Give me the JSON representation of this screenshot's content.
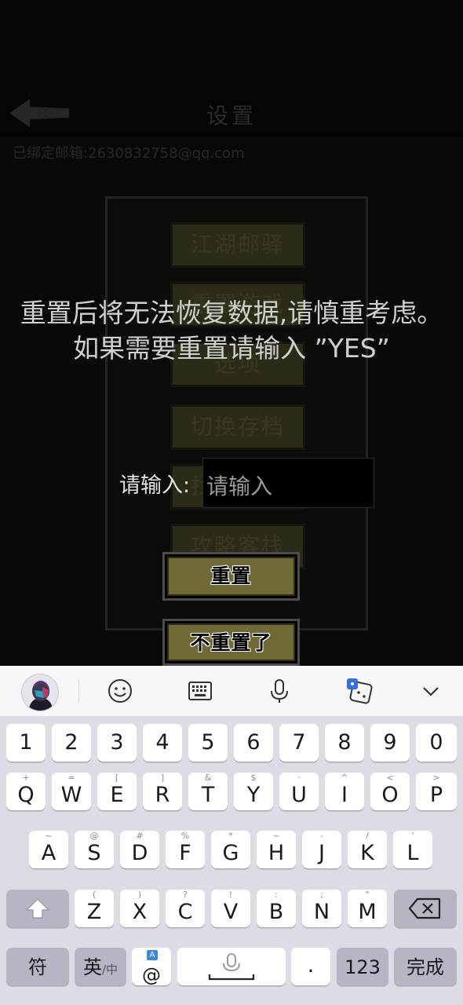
{
  "background": {
    "title": "设置",
    "email": "已绑定邮箱:2630832758@qq.com",
    "menu": [
      "江湖邮驿",
      "重置游戏",
      "选项",
      "切换存档",
      "找回存档",
      "攻略客栈"
    ]
  },
  "dialog": {
    "warning_line1": "重置后将无法恢复数据,请慎重考虑。",
    "warning_line2": "如果需要重置请输入 ”YES”",
    "input_label": "请输入:",
    "input_placeholder": "请输入",
    "input_value": "",
    "confirm_label": "重置",
    "cancel_label": "不重置了"
  },
  "keyboard": {
    "toolbar": [
      "avatar",
      "emoji-icon",
      "keyboard-icon",
      "microphone-icon",
      "dice-icon",
      "chevron-down-icon"
    ],
    "numbers": [
      "1",
      "2",
      "3",
      "4",
      "5",
      "6",
      "7",
      "8",
      "9",
      "0"
    ],
    "row1": [
      {
        "k": "Q",
        "h": "+"
      },
      {
        "k": "W",
        "h": "="
      },
      {
        "k": "E",
        "h": "["
      },
      {
        "k": "R",
        "h": "]"
      },
      {
        "k": "T",
        "h": "&"
      },
      {
        "k": "Y",
        "h": "$"
      },
      {
        "k": "U",
        "h": "·"
      },
      {
        "k": "I",
        "h": "^"
      },
      {
        "k": "O",
        "h": "<"
      },
      {
        "k": "P",
        "h": ">"
      }
    ],
    "row2": [
      {
        "k": "A",
        "h": "~"
      },
      {
        "k": "S",
        "h": "@"
      },
      {
        "k": "D",
        "h": "#"
      },
      {
        "k": "F",
        "h": "%"
      },
      {
        "k": "G",
        "h": "*"
      },
      {
        "k": "H",
        "h": "~"
      },
      {
        "k": "J",
        "h": "-"
      },
      {
        "k": "K",
        "h": "/"
      },
      {
        "k": "L",
        "h": "'"
      }
    ],
    "row3": [
      {
        "k": "Z",
        "h": "("
      },
      {
        "k": "X",
        "h": ")"
      },
      {
        "k": "C",
        "h": "?"
      },
      {
        "k": "V",
        "h": "!"
      },
      {
        "k": "B",
        "h": ":"
      },
      {
        "k": "N",
        "h": ";"
      },
      {
        "k": "M",
        "h": "\""
      }
    ],
    "symbol_key": "符",
    "lang_key": "英",
    "lang_key_sub": "/中",
    "at_key": "@",
    "at_badge": "A",
    "period_key": ".",
    "num_key": "123",
    "done_key": "完成"
  }
}
